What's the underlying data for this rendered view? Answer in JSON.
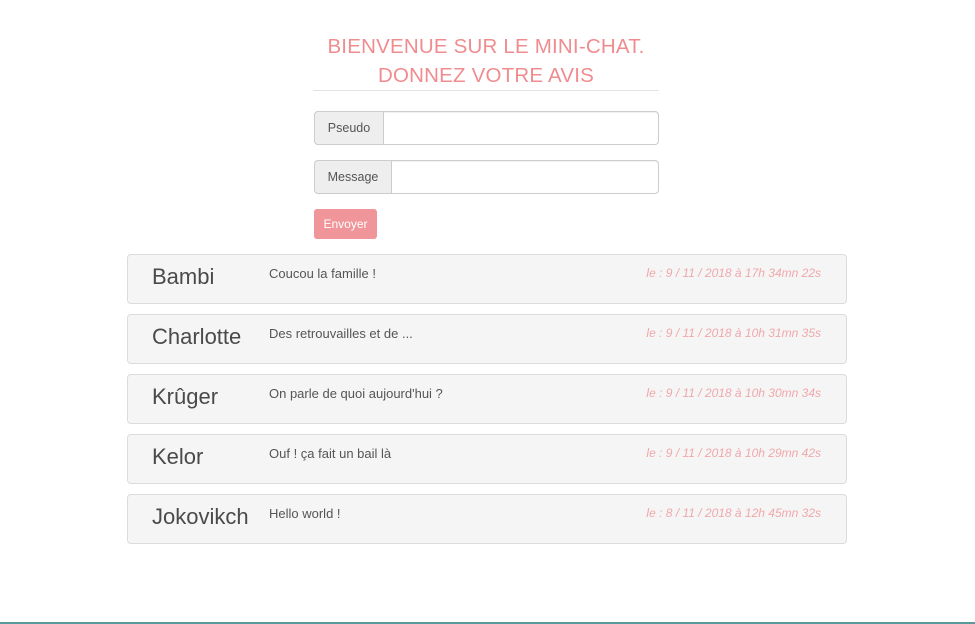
{
  "header": {
    "title_line1": "BIENVENUE SUR LE MINI-CHAT.",
    "title_line2": "DONNEZ VOTRE AVIS"
  },
  "form": {
    "pseudo_label": "Pseudo",
    "pseudo_value": "",
    "message_label": "Message",
    "message_value": "",
    "submit_label": "Envoyer"
  },
  "messages": [
    {
      "pseudo": "Bambi",
      "text": "Coucou la famille !",
      "date": "le : 9 / 11 / 2018 à 17h 34mn 22s"
    },
    {
      "pseudo": "Charlotte",
      "text": "Des retrouvailles et de ...",
      "date": "le : 9 / 11 / 2018 à 10h 31mn 35s"
    },
    {
      "pseudo": "Krûger",
      "text": "On parle de quoi aujourd'hui ?",
      "date": "le : 9 / 11 / 2018 à 10h 30mn 34s"
    },
    {
      "pseudo": "Kelor",
      "text": "Ouf ! ça fait un bail là",
      "date": "le : 9 / 11 / 2018 à 10h 29mn 42s"
    },
    {
      "pseudo": "Jokovikch",
      "text": "Hello world !",
      "date": "le : 8 / 11 / 2018 à 12h 45mn 32s"
    }
  ],
  "colors": {
    "accent": "#f08c8f",
    "button": "#f0959a",
    "date": "#f0a8ab"
  }
}
